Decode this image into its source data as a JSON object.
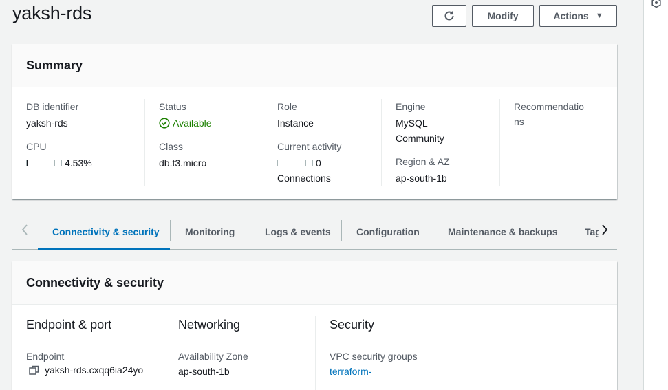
{
  "page": {
    "title": "yaksh-rds"
  },
  "toolbar": {
    "refresh_icon": "refresh-icon",
    "modify_label": "Modify",
    "actions_label": "Actions",
    "actions_caret": "▼"
  },
  "summary": {
    "title": "Summary",
    "db_identifier_label": "DB identifier",
    "db_identifier_value": "yaksh-rds",
    "cpu_label": "CPU",
    "cpu_value": "4.53%",
    "cpu_percent": 4.53,
    "status_label": "Status",
    "status_value": "Available",
    "status_color": "#1d8102",
    "class_label": "Class",
    "class_value": "db.t3.micro",
    "role_label": "Role",
    "role_value": "Instance",
    "current_activity_label": "Current activity",
    "current_activity_value": "0",
    "current_activity_unit": "Connections",
    "engine_label": "Engine",
    "engine_value_line1": "MySQL",
    "engine_value_line2": "Community",
    "region_label": "Region & AZ",
    "region_value": "ap-south-1b",
    "recommendations_line1": "Recommendatio",
    "recommendations_line2": "ns"
  },
  "tabs": {
    "items": [
      {
        "label": "Connectivity & security",
        "active": true
      },
      {
        "label": "Monitoring",
        "active": false
      },
      {
        "label": "Logs & events",
        "active": false
      },
      {
        "label": "Configuration",
        "active": false
      },
      {
        "label": "Maintenance & backups",
        "active": false
      },
      {
        "label": "Tags",
        "active": false
      }
    ],
    "accent_color": "#0073bb"
  },
  "connectivity": {
    "title": "Connectivity & security",
    "endpoint_section_title": "Endpoint & port",
    "endpoint_label": "Endpoint",
    "endpoint_value": "yaksh-rds.cxqq6ia24yo",
    "networking_section_title": "Networking",
    "az_label": "Availability Zone",
    "az_value": "ap-south-1b",
    "security_section_title": "Security",
    "vpc_sg_label": "VPC security groups",
    "vpc_sg_value": "terraform-"
  }
}
